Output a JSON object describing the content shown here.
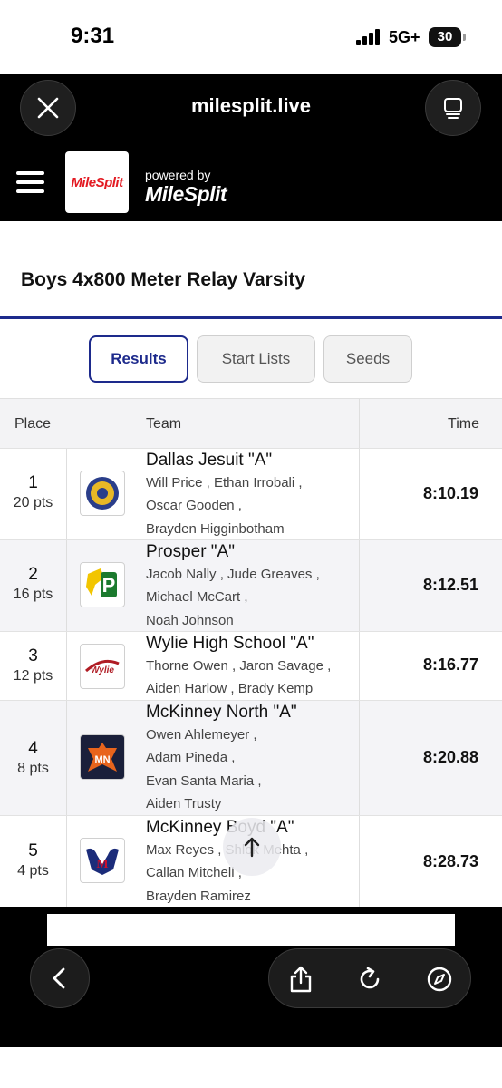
{
  "status_bar": {
    "time": "9:31",
    "network": "5G+",
    "battery": "30"
  },
  "browser": {
    "url": "milesplit.live"
  },
  "site": {
    "logo_text": "MileSplit",
    "powered_by": "powered by",
    "powered_logo": "MileSplit"
  },
  "event": {
    "title": "Boys 4x800 Meter Relay Varsity"
  },
  "tabs": [
    {
      "label": "Results",
      "active": true
    },
    {
      "label": "Start Lists",
      "active": false
    },
    {
      "label": "Seeds",
      "active": false
    }
  ],
  "table": {
    "headers": {
      "place": "Place",
      "team": "Team",
      "time": "Time"
    },
    "rows": [
      {
        "place": "1",
        "pts": "20 pts",
        "team": "Dallas Jesuit \"A\"",
        "runners": [
          "Will Price , Ethan Irrobali ,",
          "Oscar Gooden ,",
          "Brayden Higginbotham"
        ],
        "time": "8:10.19"
      },
      {
        "place": "2",
        "pts": "16 pts",
        "team": "Prosper \"A\"",
        "runners": [
          "Jacob Nally , Jude Greaves ,",
          "Michael McCart ,",
          "Noah Johnson"
        ],
        "time": "8:12.51"
      },
      {
        "place": "3",
        "pts": "12 pts",
        "team": "Wylie High School \"A\"",
        "runners": [
          "Thorne Owen , Jaron Savage ,",
          "Aiden Harlow , Brady Kemp"
        ],
        "time": "8:16.77"
      },
      {
        "place": "4",
        "pts": "8 pts",
        "team": "McKinney North \"A\"",
        "runners": [
          "Owen Ahlemeyer ,",
          "Adam Pineda ,",
          "Evan Santa Maria ,",
          "Aiden Trusty"
        ],
        "time": "8:20.88"
      },
      {
        "place": "5",
        "pts": "4 pts",
        "team": "McKinney Boyd \"A\"",
        "runners": [
          "Max Reyes , Shlok Mehta ,",
          "Callan Mitchell ,",
          "Brayden Ramirez"
        ],
        "time": "8:28.73"
      }
    ]
  },
  "colors": {
    "accent": "#1d2a8c",
    "brand_red": "#e31b23"
  },
  "icons": [
    "close-icon",
    "tabs-icon",
    "hamburger-icon",
    "scroll-top-icon",
    "back-icon",
    "share-icon",
    "reload-icon",
    "compass-icon"
  ]
}
